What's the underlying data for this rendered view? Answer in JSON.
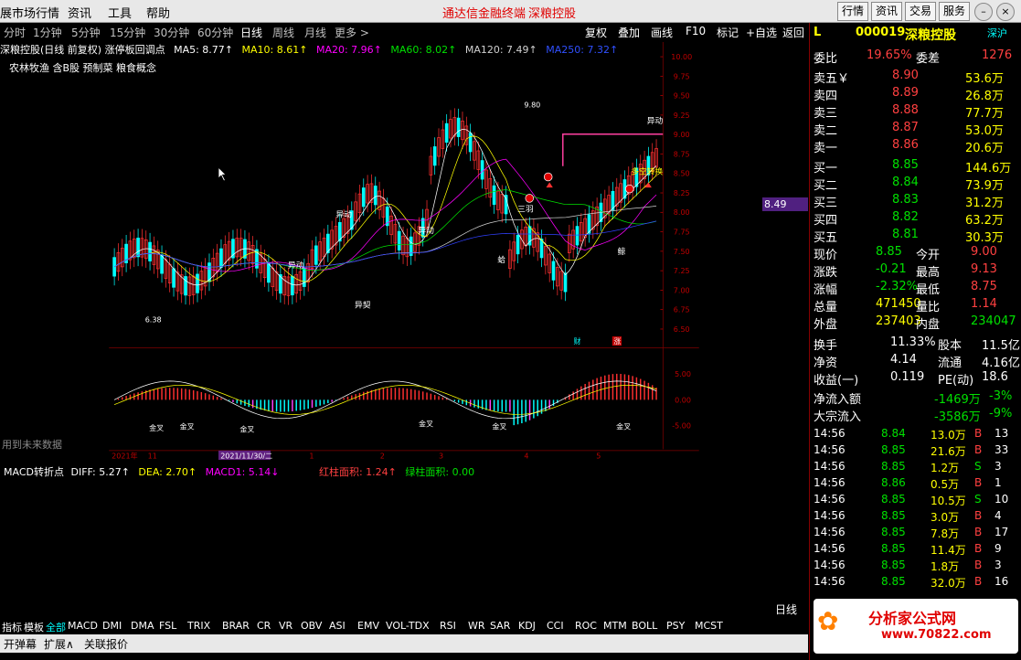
{
  "menu": {
    "items": [
      "展市场行情",
      "资讯",
      "工具",
      "帮助"
    ],
    "center_title": "通达信金融终端",
    "center_stock": "深粮控股",
    "right_buttons": [
      "行情",
      "资讯",
      "交易",
      "服务"
    ]
  },
  "period_bar": {
    "periods": [
      "分时",
      "1分钟",
      "5分钟",
      "15分钟",
      "30分钟",
      "60分钟",
      "日线",
      "周线",
      "月线",
      "更多 >"
    ],
    "active": "日线",
    "tools": [
      "复权",
      "叠加",
      "画线",
      "F10",
      "标记",
      "+自选",
      "返回"
    ]
  },
  "chart_info": {
    "title": "深粮控股(日线 前复权) 涨停板回调点",
    "ma5": "MA5: 8.77↑",
    "ma10": "MA10: 8.61↑",
    "ma20": "MA20: 7.96↑",
    "ma60": "MA60: 8.02↑",
    "ma120": "MA120: 7.49↑",
    "ma250": "MA250: 7.32↑",
    "concepts": "农林牧渔 含B股 预制菜 粮食概念",
    "future_note": "用到未来数据",
    "last_price_tag": "8.49",
    "high_label": "9.80",
    "low_label": "6.38",
    "events": [
      "异动",
      "异动",
      "异动",
      "异动",
      "多空转换",
      "异契",
      "三羽",
      "蛤",
      "鲸"
    ],
    "badges": [
      "财",
      "涨"
    ]
  },
  "chart_data": {
    "type": "candlestick",
    "ylim": [
      6.5,
      10.0
    ],
    "y_ticks": [
      "10.00",
      "9.75",
      "9.50",
      "9.25",
      "9.00",
      "8.75",
      "8.50",
      "8.25",
      "8.00",
      "7.75",
      "7.50",
      "7.25",
      "7.00",
      "6.75",
      "6.50"
    ],
    "x_ticks": [
      "2021年",
      "11",
      "2021/11/30/二",
      "1",
      "2",
      "3",
      "4",
      "5"
    ],
    "macd_ticks": [
      "5.00",
      "0.00",
      "-5.00"
    ],
    "macd": {
      "title": "MACD转折点",
      "diff": "DIFF: 5.27↑",
      "dea": "DEA: 2.70↑",
      "macd1": "MACD1: 5.14↓",
      "red_area": "红柱面积: 1.24↑",
      "green_area": "绿柱面积: 0.00",
      "cross_label": "金叉"
    }
  },
  "right_panel": {
    "logo": "L",
    "code": "000019",
    "name": "深粮控股",
    "market": "深沪",
    "weibi": {
      "label": "委比",
      "value": "19.65%",
      "diff_label": "委差",
      "diff_value": "1276"
    },
    "sells": [
      {
        "label": "卖五",
        "unit": "￥",
        "price": "8.90",
        "vol": "53.6万"
      },
      {
        "label": "卖四",
        "price": "8.89",
        "vol": "26.8万"
      },
      {
        "label": "卖三",
        "price": "8.88",
        "vol": "77.7万"
      },
      {
        "label": "卖二",
        "price": "8.87",
        "vol": "53.0万"
      },
      {
        "label": "卖一",
        "price": "8.86",
        "vol": "20.6万"
      }
    ],
    "buys": [
      {
        "label": "买一",
        "price": "8.85",
        "vol": "144.6万"
      },
      {
        "label": "买二",
        "price": "8.84",
        "vol": "73.9万"
      },
      {
        "label": "买三",
        "price": "8.83",
        "vol": "31.2万"
      },
      {
        "label": "买四",
        "price": "8.82",
        "vol": "63.2万"
      },
      {
        "label": "买五",
        "price": "8.81",
        "vol": "30.3万"
      }
    ],
    "stats": [
      {
        "l1": "现价",
        "v1": "8.85",
        "l2": "今开",
        "v2": "9.00"
      },
      {
        "l1": "涨跌",
        "v1": "-0.21",
        "l2": "最高",
        "v2": "9.13"
      },
      {
        "l1": "涨幅",
        "v1": "-2.32%",
        "l2": "最低",
        "v2": "8.75"
      },
      {
        "l1": "总量",
        "v1": "471450",
        "l2": "量比",
        "v2": "1.14"
      },
      {
        "l1": "外盘",
        "v1": "237403",
        "l2": "内盘",
        "v2": "234047"
      }
    ],
    "stats2": [
      {
        "l1": "换手",
        "v1": "11.33%",
        "l2": "股本",
        "v2": "11.5亿"
      },
      {
        "l1": "净资",
        "v1": "4.14",
        "l2": "流通",
        "v2": "4.16亿"
      },
      {
        "l1": "收益(一)",
        "v1": "0.119",
        "l2": "PE(动)",
        "v2": "18.6"
      }
    ],
    "flows": [
      {
        "label": "净流入额",
        "value": "-1469万",
        "pct": "-3%"
      },
      {
        "label": "大宗流入",
        "value": "-3586万",
        "pct": "-9%"
      }
    ],
    "ticks": [
      {
        "t": "14:56",
        "p": "8.84",
        "v": "13.0万",
        "d": "B",
        "n": "13"
      },
      {
        "t": "14:56",
        "p": "8.85",
        "v": "21.6万",
        "d": "B",
        "n": "33"
      },
      {
        "t": "14:56",
        "p": "8.85",
        "v": "1.2万",
        "d": "S",
        "n": "3"
      },
      {
        "t": "14:56",
        "p": "8.86",
        "v": "0.5万",
        "d": "B",
        "n": "1"
      },
      {
        "t": "14:56",
        "p": "8.85",
        "v": "10.5万",
        "d": "S",
        "n": "10"
      },
      {
        "t": "14:56",
        "p": "8.85",
        "v": "3.0万",
        "d": "B",
        "n": "4"
      },
      {
        "t": "14:56",
        "p": "8.85",
        "v": "7.8万",
        "d": "B",
        "n": "17"
      },
      {
        "t": "14:56",
        "p": "8.85",
        "v": "11.4万",
        "d": "B",
        "n": "9"
      },
      {
        "t": "14:56",
        "p": "8.85",
        "v": "1.8万",
        "d": "B",
        "n": "3"
      },
      {
        "t": "14:56",
        "p": "8.85",
        "v": "32.0万",
        "d": "B",
        "n": "16"
      }
    ]
  },
  "bottom": {
    "period_label": "日线",
    "tabs": [
      "指标",
      "模板",
      "全部",
      "MACD",
      "DMI",
      "DMA",
      "FSL",
      "TRIX",
      "BRAR",
      "CR",
      "VR",
      "OBV",
      "ASI",
      "EMV",
      "VOL-TDX",
      "RSI",
      "WR",
      "SAR",
      "KDJ",
      "CCI",
      "ROC",
      "MTM",
      "BOLL",
      "PSY",
      "MCST"
    ],
    "status": [
      "开弹幕",
      "扩展∧",
      "关联报价"
    ],
    "watermark": "分析家公式网",
    "watermark_url": "www.70822.com"
  },
  "colors": {
    "up": "#ff3030",
    "down": "#00ffff",
    "ma5": "#ffffff",
    "ma10": "#ffff00",
    "ma20": "#ff00ff",
    "ma60": "#00e000",
    "ma120": "#d0d0d0",
    "ma250": "#3040ff"
  }
}
